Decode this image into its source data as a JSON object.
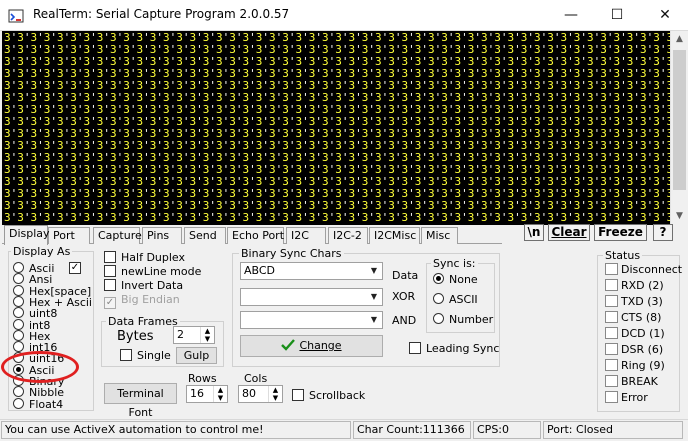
{
  "window": {
    "title": "RealTerm: Serial Capture Program 2.0.0.57",
    "controls": {
      "minimize": "—",
      "maximize": "☐",
      "close": "✕"
    }
  },
  "terminal": {
    "fill_pattern": "3",
    "rows": 16,
    "cols": 52
  },
  "tabs": [
    "Display",
    "Port",
    "Capture",
    "Pins",
    "Send",
    "Echo Port",
    "I2C",
    "I2C-2",
    "I2CMisc",
    "Misc"
  ],
  "active_tab": "Display",
  "toolbar_buttons": {
    "newline": "\\n",
    "clear": "Clear",
    "freeze": "Freeze",
    "help": "?"
  },
  "display_as": {
    "label": "Display As",
    "options": [
      "Ascii",
      "Ansi",
      "Hex[space]",
      "Hex + Ascii",
      "uint8",
      "int8",
      "Hex",
      "int16",
      "uint16",
      "Ascii",
      "Binary",
      "Nibble",
      "Float4"
    ],
    "selected_index": 9
  },
  "options": {
    "half_duplex": "Half Duplex",
    "newline_mode": "newLine mode",
    "invert_data": "Invert Data",
    "big_endian": "Big Endian"
  },
  "data_frames": {
    "label": "Data Frames",
    "bytes_label": "Bytes",
    "bytes_value": "2",
    "single": "Single",
    "gulp": "Gulp"
  },
  "rows": {
    "label": "Rows",
    "value": "16"
  },
  "cols": {
    "label": "Cols",
    "value": "80"
  },
  "terminal_font": "Terminal Font",
  "scrollback": "Scrollback",
  "binary_sync": {
    "label": "Binary Sync Chars",
    "chars_value": "ABCD",
    "data_label": "Data",
    "xor_label": "XOR",
    "and_label": "AND",
    "change": "Change",
    "leading_sync": "Leading Sync"
  },
  "sync_is": {
    "label": "Sync is:",
    "options": [
      "None",
      "ASCII",
      "Number"
    ],
    "selected_index": 0
  },
  "status": {
    "label": "Status",
    "items": [
      "Disconnect",
      "RXD (2)",
      "TXD (3)",
      "CTS (8)",
      "DCD (1)",
      "DSR (6)",
      "Ring (9)",
      "BREAK",
      "Error"
    ]
  },
  "statusbar": {
    "message": "You can use ActiveX automation to control me!",
    "char_count": "Char Count:111366",
    "cps": "CPS:0",
    "port": "Port: Closed"
  },
  "colors": {
    "terminal_bg": "#000000",
    "terminal_fg": "#ffff3a",
    "annotation": "#e02020",
    "change_check": "#1a8f1a"
  }
}
